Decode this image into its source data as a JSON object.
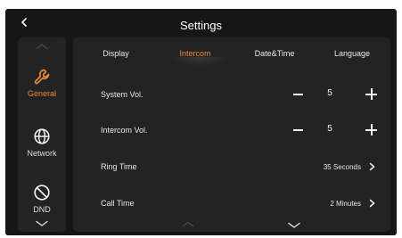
{
  "header": {
    "title": "Settings"
  },
  "sidebar": {
    "items": [
      {
        "label": "General",
        "icon": "wrench-icon",
        "active": true
      },
      {
        "label": "Network",
        "icon": "globe-icon",
        "active": false
      },
      {
        "label": "DND",
        "icon": "do-not-disturb-icon",
        "active": false
      }
    ]
  },
  "tabs": [
    {
      "label": "Display",
      "active": false
    },
    {
      "label": "Intercom",
      "active": true
    },
    {
      "label": "Date&Time",
      "active": false
    },
    {
      "label": "Language",
      "active": false
    }
  ],
  "rows": {
    "system_vol": {
      "label": "System Vol.",
      "value": "5"
    },
    "intercom_vol": {
      "label": "Intercom Vol.",
      "value": "5"
    },
    "ring_time": {
      "label": "Ring Time",
      "value": "35 Seconds"
    },
    "call_time": {
      "label": "Call Time",
      "value": "2 Minutes"
    }
  },
  "colors": {
    "accent": "#e8893a",
    "background": "#161616",
    "panel": "#232323",
    "text": "#e6e6e6"
  }
}
